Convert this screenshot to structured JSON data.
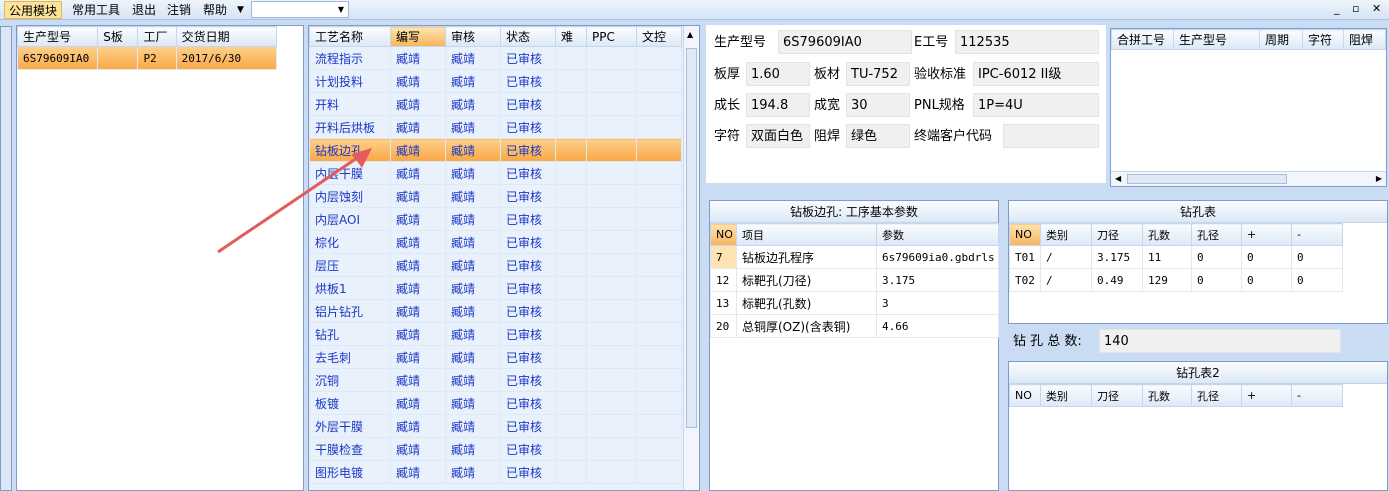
{
  "menu": {
    "items": [
      "公用模块",
      "常用工具",
      "退出",
      "注销",
      "帮助"
    ],
    "window_controls": [
      "▾",
      "_",
      "▫",
      "✕"
    ]
  },
  "orders": {
    "columns": [
      "生产型号",
      "S板",
      "工厂",
      "交货日期"
    ],
    "rows": [
      {
        "model": "6S79609IA0",
        "s": "",
        "factory": "P2",
        "date": "2017/6/30"
      }
    ]
  },
  "process": {
    "columns": [
      "工艺名称",
      "编写",
      "审核",
      "状态",
      "难",
      "PPC",
      "文控"
    ],
    "rows": [
      [
        "流程指示",
        "臧靖",
        "臧靖",
        "已审核"
      ],
      [
        "计划投料",
        "臧靖",
        "臧靖",
        "已审核"
      ],
      [
        "开料",
        "臧靖",
        "臧靖",
        "已审核"
      ],
      [
        "开料后烘板",
        "臧靖",
        "臧靖",
        "已审核"
      ],
      [
        "钻板边孔",
        "臧靖",
        "臧靖",
        "已审核"
      ],
      [
        "内层干膜",
        "臧靖",
        "臧靖",
        "已审核"
      ],
      [
        "内层蚀刻",
        "臧靖",
        "臧靖",
        "已审核"
      ],
      [
        "内层AOI",
        "臧靖",
        "臧靖",
        "已审核"
      ],
      [
        "棕化",
        "臧靖",
        "臧靖",
        "已审核"
      ],
      [
        "层压",
        "臧靖",
        "臧靖",
        "已审核"
      ],
      [
        "烘板1",
        "臧靖",
        "臧靖",
        "已审核"
      ],
      [
        "铝片钻孔",
        "臧靖",
        "臧靖",
        "已审核"
      ],
      [
        "钻孔",
        "臧靖",
        "臧靖",
        "已审核"
      ],
      [
        "去毛刺",
        "臧靖",
        "臧靖",
        "已审核"
      ],
      [
        "沉铜",
        "臧靖",
        "臧靖",
        "已审核"
      ],
      [
        "板镀",
        "臧靖",
        "臧靖",
        "已审核"
      ],
      [
        "外层干膜",
        "臧靖",
        "臧靖",
        "已审核"
      ],
      [
        "干膜检查",
        "臧靖",
        "臧靖",
        "已审核"
      ],
      [
        "图形电镀",
        "臧靖",
        "臧靖",
        "已审核"
      ]
    ],
    "selected_index": 4
  },
  "info": {
    "model_label": "生产型号",
    "model_value": "6S79609IA0",
    "eno_label": "E工号",
    "eno_value": "112535",
    "thick_label": "板厚",
    "thick_value": "1.60",
    "material_label": "板材",
    "material_value": "TU-752",
    "standard_label": "验收标准",
    "standard_value": "IPC-6012 II级",
    "length_label": "成长",
    "length_value": "194.8",
    "width_label": "成宽",
    "width_value": "30",
    "pnl_label": "PNL规格",
    "pnl_value": "1P=4U",
    "char_label": "字符",
    "char_value": "双面白色",
    "mask_label": "阻焊",
    "mask_value": "绿色",
    "customer_label": "终端客户代码",
    "customer_value": ""
  },
  "combine": {
    "columns": [
      "合拼工号",
      "生产型号",
      "周期",
      "字符",
      "阻焊"
    ]
  },
  "params": {
    "title": "钻板边孔: 工序基本参数",
    "columns": [
      "NO",
      "项目",
      "参数"
    ],
    "rows": [
      [
        "7",
        "钻板边孔程序",
        "6s79609ia0.gbdrls"
      ],
      [
        "12",
        "标靶孔(刀径)",
        "3.175"
      ],
      [
        "13",
        "标靶孔(孔数)",
        "3"
      ],
      [
        "20",
        "总铜厚(OZ)(含表铜)",
        "4.66"
      ]
    ]
  },
  "drill": {
    "title": "钻孔表",
    "columns": [
      "NO",
      "类别",
      "刀径",
      "孔数",
      "孔径",
      "+",
      "-"
    ],
    "rows": [
      [
        "T01",
        "/",
        "3.175",
        "11",
        "0",
        "0",
        "0"
      ],
      [
        "T02",
        "/",
        "0.49",
        "129",
        "0",
        "0",
        "0"
      ]
    ],
    "total_label": "钻 孔 总 数:",
    "total_value": "140"
  },
  "drill2": {
    "title": "钻孔表2",
    "columns": [
      "NO",
      "类别",
      "刀径",
      "孔数",
      "孔径",
      "+",
      "-"
    ]
  }
}
